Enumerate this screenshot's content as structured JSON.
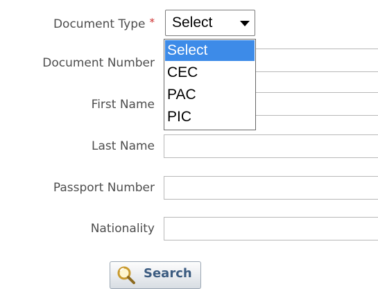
{
  "form": {
    "document_type": {
      "label": "Document Type",
      "required_marker": "*",
      "selected": "Select",
      "options": [
        "Select",
        "CEC",
        "PAC",
        "PIC"
      ],
      "highlighted_option": "Select"
    },
    "document_number": {
      "label": "Document Number",
      "value": ""
    },
    "first_name": {
      "label": "First Name",
      "value": ""
    },
    "last_name": {
      "label": "Last Name",
      "value": ""
    },
    "passport_number": {
      "label": "Passport Number",
      "value": ""
    },
    "nationality": {
      "label": "Nationality",
      "value": ""
    }
  },
  "search_button": {
    "label": "Search",
    "icon": "magnifier-icon"
  },
  "colors": {
    "label_text": "#4d4d4d",
    "required_marker": "#cc2b2b",
    "highlight": "#3d8be8",
    "button_text": "#3b5b80"
  }
}
